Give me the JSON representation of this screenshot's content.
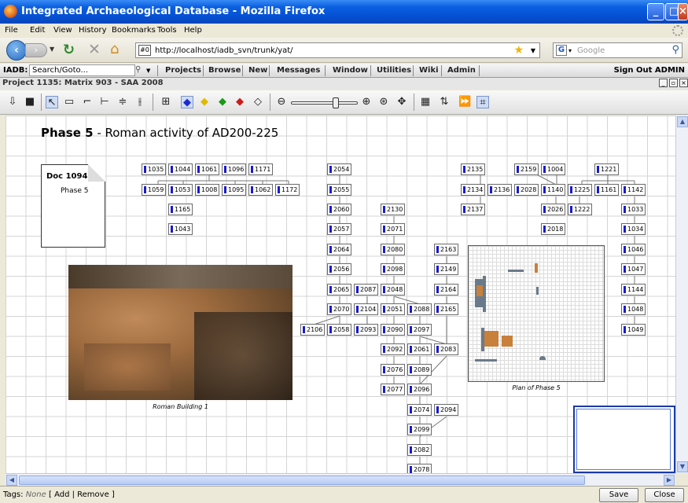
{
  "window": {
    "title": "Integrated Archaeological Database - Mozilla Firefox"
  },
  "menu": [
    "File",
    "Edit",
    "View",
    "History",
    "Bookmarks",
    "Tools",
    "Help"
  ],
  "nav": {
    "url": "http://localhost/iadb_svn/trunk/yat/",
    "site_icon": "#0",
    "search_placeholder": "Google"
  },
  "app": {
    "label": "IADB:",
    "goto_placeholder": "Search/Goto...",
    "items": [
      "Projects",
      "Browse",
      "New",
      "Messages",
      "Window",
      "Utilities",
      "Wiki",
      "Admin"
    ],
    "signout": "Sign Out ADMIN"
  },
  "project": {
    "title": "Project 1135: Matrix 903 - SAA 2008"
  },
  "canvas": {
    "phase_bold": "Phase 5",
    "phase_rest": " - Roman activity of AD200-225",
    "doc_title": "Doc 1094",
    "doc_sub": "Phase 5",
    "photo_caption": "Roman Building 1",
    "plan_caption": "Plan of Phase 5"
  },
  "nodes": [
    "1035",
    "1044",
    "1061",
    "1096",
    "1171",
    "1059",
    "1053",
    "1008",
    "1095",
    "1062",
    "1172",
    "1165",
    "1043",
    "2054",
    "2055",
    "2060",
    "2057",
    "2064",
    "2056",
    "2065",
    "2070",
    "2058",
    "2106",
    "2087",
    "2104",
    "2093",
    "2130",
    "2071",
    "2080",
    "2098",
    "2048",
    "2051",
    "2090",
    "2092",
    "2076",
    "2077",
    "2097",
    "2061",
    "2089",
    "2096",
    "2088",
    "2083",
    "2074",
    "2094",
    "2099",
    "2082",
    "2078",
    "2163",
    "2149",
    "2164",
    "2165",
    "2135",
    "2134",
    "2136",
    "2137",
    "2159",
    "2028",
    "1004",
    "1140",
    "2026",
    "2018",
    "1221",
    "1225",
    "1222",
    "1161",
    "1142",
    "1033",
    "1034",
    "1046",
    "1047",
    "1144",
    "1048",
    "1049"
  ],
  "status": {
    "tags_label": "Tags:",
    "tags_value": "None",
    "tags_actions": "[ Add | Remove ]",
    "save": "Save",
    "close": "Close"
  }
}
